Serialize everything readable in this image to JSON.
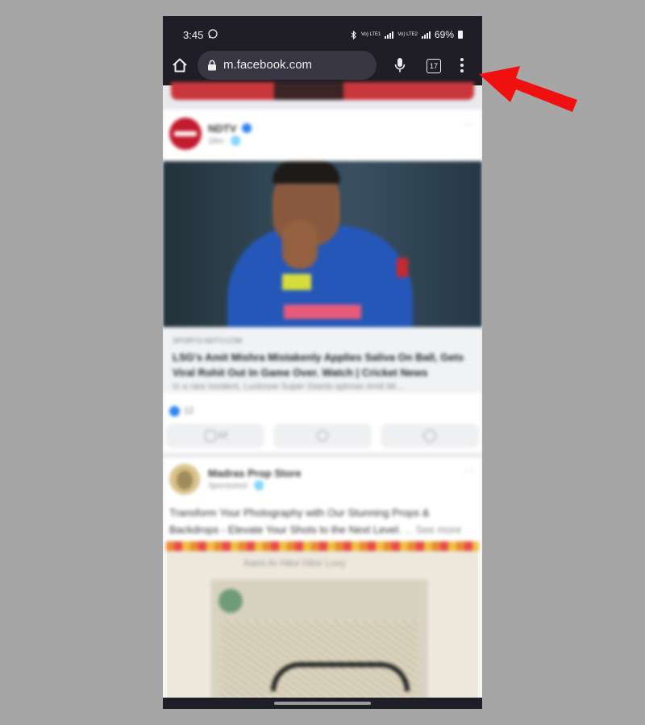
{
  "status_bar": {
    "time": "3:45",
    "battery": "69%",
    "network": [
      "Vo) LTE1",
      "Vo) LTE2"
    ]
  },
  "browser": {
    "url": "m.facebook.com",
    "tab_count": "17"
  },
  "feed": {
    "post1": {
      "page_name": "NDTV",
      "meta": "18m · 🌐",
      "link_source": "SPORTS.NDTV.COM",
      "link_title": "LSG's Amit Mishra Mistakenly Applies Saliva On Ball, Gets Viral Rohit Out In Game Over. Watch | Cricket News",
      "link_description": "In a rare incident, Lucknow Super Giants spinner Amit Mi...",
      "reaction_count": "12",
      "like_count": "12"
    },
    "post2": {
      "page_name": "Madras Prop Store",
      "meta": "Sponsored · 🌐",
      "text": "Transform Your Photography with Our Stunning Props & Backdrops - Elevate Your Shots to the Next Level.",
      "see_more": "... See more",
      "image_caption": "Aami Ar Hilor Hilor Lovy"
    }
  },
  "annotation": {
    "arrow_color": "#f01010"
  }
}
